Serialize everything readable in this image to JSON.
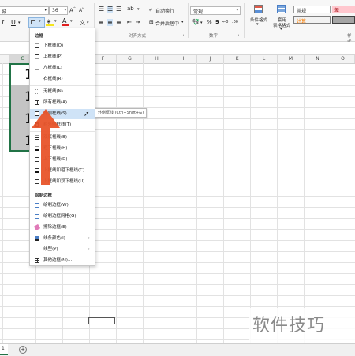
{
  "ribbon": {
    "font_box_suffix": "城",
    "font_size": "36",
    "bold_glyph": "I",
    "underline_glyph": "U",
    "font_color_glyph": "A",
    "wrap_text": "自动换行",
    "merge_center": "合并后居中",
    "number_format": "常规",
    "percent_glyph": "%",
    "comma_glyph": "9",
    "group_alignment": "对齐方式",
    "group_number": "数字",
    "conditional_format": "条件格式",
    "format_as_table_line1": "套用",
    "format_as_table_line2": "表格格式",
    "style_normal": "常规",
    "style_bad": "差",
    "style_calc": "计算",
    "group_styles_partial": "样式"
  },
  "columns": [
    "C",
    "F",
    "G",
    "H",
    "I",
    "J",
    "K",
    "L",
    "M",
    "N",
    "O"
  ],
  "cells": {
    "value_digit": "1"
  },
  "menu": {
    "header_borders": "边框",
    "items": [
      "下框线(O)",
      "上框线(P)",
      "左框线(L)",
      "右框线(R)",
      "无框线(N)",
      "所有框线(A)",
      "外侧框线(S)",
      "粗外侧框线(T)",
      "双底框线(B)",
      "粗下框线(H)",
      "上下框线(D)",
      "上框线和粗下框线(C)",
      "上框线和双下框线(U)"
    ],
    "header_draw": "绘制边框",
    "draw_items": [
      "绘制边框(W)",
      "绘制边框网格(G)",
      "擦除边框(E)",
      "线条颜色(I)",
      "线型(Y)",
      "其他边框(M)..."
    ]
  },
  "tooltip": "外侧框线 (Ctrl+Shift+&)",
  "sheet_tab": "1",
  "watermark": "软件技巧",
  "colors": {
    "selected_cells": "#bdbdbd",
    "arrow": "#e8542a",
    "highlight": "#cfe3f7"
  }
}
